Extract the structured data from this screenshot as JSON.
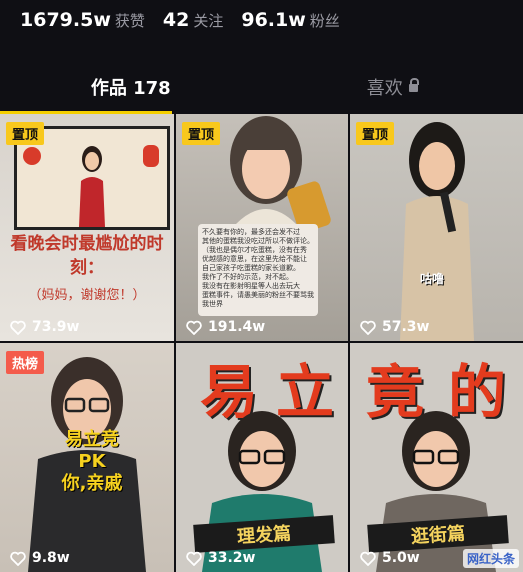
{
  "stats": [
    {
      "value": "1679.5w",
      "label": "获赞"
    },
    {
      "value": "42",
      "label": "关注"
    },
    {
      "value": "96.1w",
      "label": "粉丝"
    }
  ],
  "tabs": {
    "works": "作品 178",
    "likes": "喜欢"
  },
  "tiles": [
    {
      "badge": "置顶",
      "likes": "73.9w",
      "caption": "看晚会时最尴尬的时刻：",
      "sub": "（妈妈，谢谢您！）"
    },
    {
      "badge": "置顶",
      "likes": "191.4w",
      "card_lines": [
        "不久要有你的，最多还会发不过",
        "其他的蛋糕我没吃过所以不做评论。",
        "（我也是偶尔才吃蛋糕，没有在秀",
        "优越感的意思，在这里先给不能让",
        "自己家孩子吃蛋糕的家长道歉。",
        "我作了不好的示范，对不起。",
        "我没有在影射明星等人出去玩大",
        "蛋糕事件，请愚美丽的粉丝不要骂我",
        "我世界"
      ]
    },
    {
      "badge": "置顶",
      "likes": "57.3w",
      "sticker": "咕噜"
    },
    {
      "badge": "热榜",
      "likes": "9.8w",
      "caption": [
        "易立竞",
        "PK",
        "你,亲戚"
      ]
    },
    {
      "likes": "33.2w",
      "big": [
        "易",
        "立"
      ],
      "banner": "理发篇"
    },
    {
      "likes": "5.0w",
      "big": [
        "竟",
        "的"
      ],
      "banner": "逛街篇",
      "watermark": "网红头条"
    }
  ],
  "colors": {
    "accent": "#f5cf00",
    "pin_badge": "#f8c81c",
    "hot_badge": "#f45b4b",
    "background": "#0f0f14"
  }
}
